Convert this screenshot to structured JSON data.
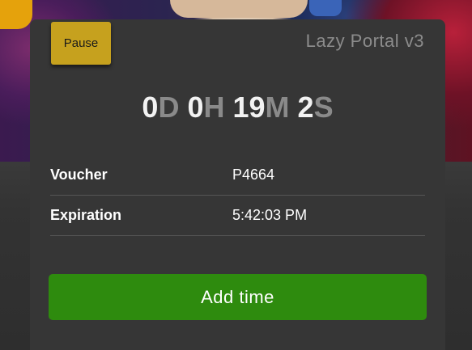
{
  "header": {
    "pause_label": "Pause",
    "portal_title": "Lazy Portal v3"
  },
  "countdown": {
    "days": "0",
    "days_unit": "D",
    "hours": "0",
    "hours_unit": "H",
    "minutes": "19",
    "minutes_unit": "M",
    "seconds": "2",
    "seconds_unit": "S"
  },
  "info": {
    "rows": [
      {
        "label": "Voucher",
        "value": "P4664"
      },
      {
        "label": "Expiration",
        "value": "5:42:03 PM"
      }
    ]
  },
  "actions": {
    "add_time_label": "Add time"
  },
  "colors": {
    "pause_button": "#c6a11e",
    "add_time_button": "#2e8b0e",
    "card_background": "#363636",
    "unit_text": "#8a8a8a"
  }
}
